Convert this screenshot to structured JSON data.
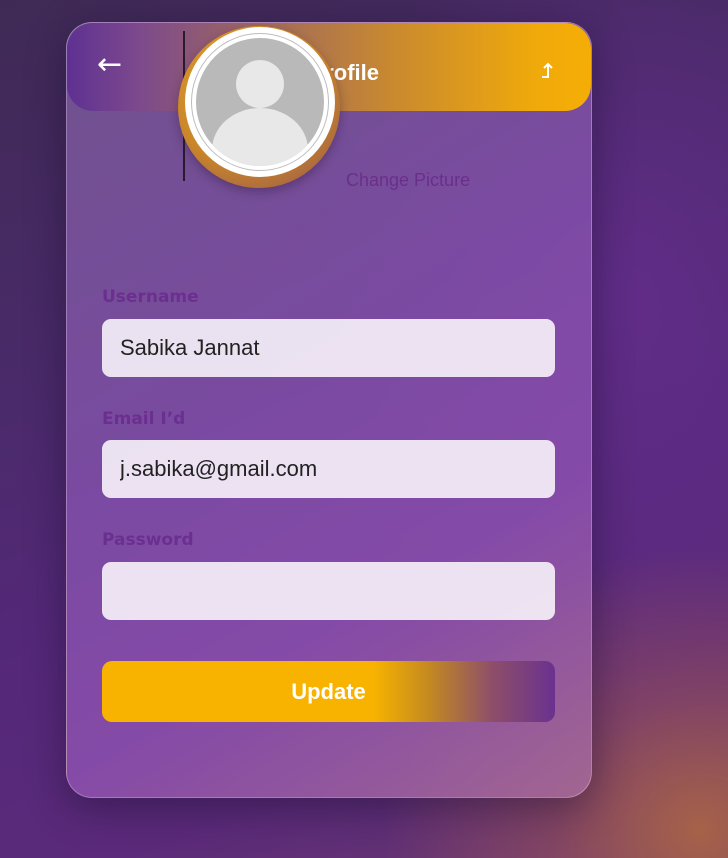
{
  "header": {
    "back_icon": "arrow-left-icon",
    "title": "Edit Profile",
    "logout_icon": "logout-arrow-icon"
  },
  "avatar": {
    "icon": "default-user-avatar-icon",
    "change_label": "Change Picture"
  },
  "form": {
    "username_label": "Username",
    "username_value": "Sabika Jannat",
    "email_label": "Email I’d",
    "email_value": "j.sabika@gmail.com",
    "password_label": "Password",
    "password_value": "",
    "update_label": "Update"
  },
  "colors": {
    "accent": "#f7b300",
    "purple": "#6a3190",
    "label": "#6b2f8f"
  }
}
